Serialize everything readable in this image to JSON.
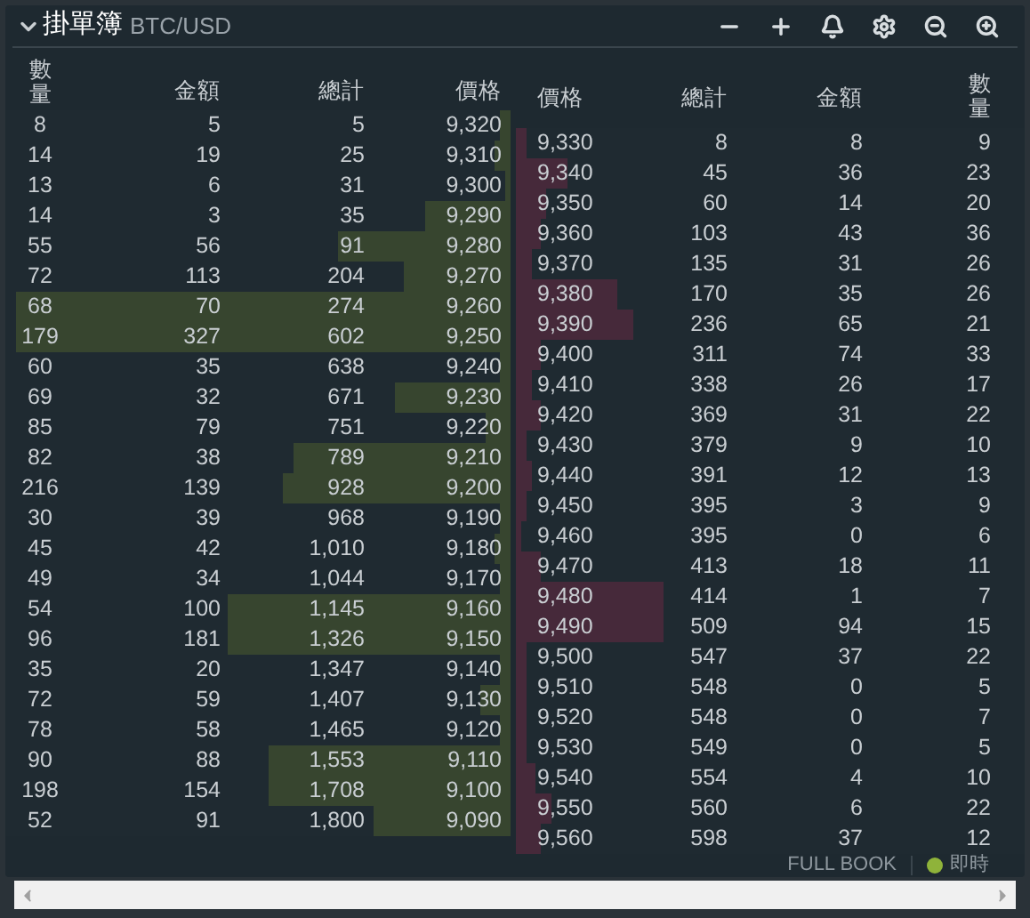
{
  "header": {
    "title": "掛單簿",
    "pair": "BTC/USD"
  },
  "bid_columns": [
    "數量",
    "金額",
    "總計",
    "價格"
  ],
  "ask_columns": [
    "價格",
    "總計",
    "金額",
    "數量"
  ],
  "bids": [
    {
      "amount": "8",
      "value": "5",
      "total": "5",
      "price": "9,320",
      "level": 0.02
    },
    {
      "amount": "14",
      "value": "19",
      "total": "25",
      "price": "9,310",
      "level": 0.03
    },
    {
      "amount": "13",
      "value": "6",
      "total": "31",
      "price": "9,300",
      "level": 0.01
    },
    {
      "amount": "14",
      "value": "3",
      "total": "35",
      "price": "9,290",
      "level": 0.17
    },
    {
      "amount": "55",
      "value": "56",
      "total": "91",
      "price": "9,280",
      "level": 0.34
    },
    {
      "amount": "72",
      "value": "113",
      "total": "204",
      "price": "9,270",
      "level": 0.21
    },
    {
      "amount": "68",
      "value": "70",
      "total": "274",
      "price": "9,260",
      "level": 0.98
    },
    {
      "amount": "179",
      "value": "327",
      "total": "602",
      "price": "9,250",
      "level": 0.98
    },
    {
      "amount": "60",
      "value": "35",
      "total": "638",
      "price": "9,240",
      "level": 0.02
    },
    {
      "amount": "69",
      "value": "32",
      "total": "671",
      "price": "9,230",
      "level": 0.23
    },
    {
      "amount": "85",
      "value": "79",
      "total": "751",
      "price": "9,220",
      "level": 0.05
    },
    {
      "amount": "82",
      "value": "38",
      "total": "789",
      "price": "9,210",
      "level": 0.43
    },
    {
      "amount": "216",
      "value": "139",
      "total": "928",
      "price": "9,200",
      "level": 0.45
    },
    {
      "amount": "30",
      "value": "39",
      "total": "968",
      "price": "9,190",
      "level": 0.02
    },
    {
      "amount": "45",
      "value": "42",
      "total": "1,010",
      "price": "9,180",
      "level": 0.03
    },
    {
      "amount": "49",
      "value": "34",
      "total": "1,044",
      "price": "9,170",
      "level": 0.02
    },
    {
      "amount": "54",
      "value": "100",
      "total": "1,145",
      "price": "9,160",
      "level": 0.56
    },
    {
      "amount": "96",
      "value": "181",
      "total": "1,326",
      "price": "9,150",
      "level": 0.56
    },
    {
      "amount": "35",
      "value": "20",
      "total": "1,347",
      "price": "9,140",
      "level": 0.02
    },
    {
      "amount": "72",
      "value": "59",
      "total": "1,407",
      "price": "9,130",
      "level": 0.06
    },
    {
      "amount": "78",
      "value": "58",
      "total": "1,465",
      "price": "9,120",
      "level": 0.02
    },
    {
      "amount": "90",
      "value": "88",
      "total": "1,553",
      "price": "9,110",
      "level": 0.48
    },
    {
      "amount": "198",
      "value": "154",
      "total": "1,708",
      "price": "9,100",
      "level": 0.48
    },
    {
      "amount": "52",
      "value": "91",
      "total": "1,800",
      "price": "9,090",
      "level": 0.27
    }
  ],
  "asks": [
    {
      "price": "9,330",
      "total": "8",
      "value": "8",
      "amount": "9",
      "level": 0.02
    },
    {
      "price": "9,340",
      "total": "45",
      "value": "36",
      "amount": "23",
      "level": 0.1
    },
    {
      "price": "9,350",
      "total": "60",
      "value": "14",
      "amount": "20",
      "level": 0.06
    },
    {
      "price": "9,360",
      "total": "103",
      "value": "43",
      "amount": "36",
      "level": 0.05
    },
    {
      "price": "9,370",
      "total": "135",
      "value": "31",
      "amount": "26",
      "level": 0.03
    },
    {
      "price": "9,380",
      "total": "170",
      "value": "35",
      "amount": "26",
      "level": 0.2
    },
    {
      "price": "9,390",
      "total": "236",
      "value": "65",
      "amount": "21",
      "level": 0.23
    },
    {
      "price": "9,400",
      "total": "311",
      "value": "74",
      "amount": "33",
      "level": 0.05
    },
    {
      "price": "9,410",
      "total": "338",
      "value": "26",
      "amount": "17",
      "level": 0.03
    },
    {
      "price": "9,420",
      "total": "369",
      "value": "31",
      "amount": "22",
      "level": 0.05
    },
    {
      "price": "9,430",
      "total": "379",
      "value": "9",
      "amount": "10",
      "level": 0.02
    },
    {
      "price": "9,440",
      "total": "391",
      "value": "12",
      "amount": "13",
      "level": 0.03
    },
    {
      "price": "9,450",
      "total": "395",
      "value": "3",
      "amount": "9",
      "level": 0.02
    },
    {
      "price": "9,460",
      "total": "395",
      "value": "0",
      "amount": "6",
      "level": 0.01
    },
    {
      "price": "9,470",
      "total": "413",
      "value": "18",
      "amount": "11",
      "level": 0.05
    },
    {
      "price": "9,480",
      "total": "414",
      "value": "1",
      "amount": "7",
      "level": 0.29
    },
    {
      "price": "9,490",
      "total": "509",
      "value": "94",
      "amount": "15",
      "level": 0.29
    },
    {
      "price": "9,500",
      "total": "547",
      "value": "37",
      "amount": "22",
      "level": 0.02
    },
    {
      "price": "9,510",
      "total": "548",
      "value": "0",
      "amount": "5",
      "level": 0.02
    },
    {
      "price": "9,520",
      "total": "548",
      "value": "0",
      "amount": "7",
      "level": 0.02
    },
    {
      "price": "9,530",
      "total": "549",
      "value": "0",
      "amount": "5",
      "level": 0.02
    },
    {
      "price": "9,540",
      "total": "554",
      "value": "4",
      "amount": "10",
      "level": 0.04
    },
    {
      "price": "9,550",
      "total": "560",
      "value": "6",
      "amount": "22",
      "level": 0.07
    },
    {
      "price": "9,560",
      "total": "598",
      "value": "37",
      "amount": "12",
      "level": 0.05
    }
  ],
  "footer": {
    "mode": "FULL BOOK",
    "status": {
      "label": "即時",
      "on": true
    }
  }
}
